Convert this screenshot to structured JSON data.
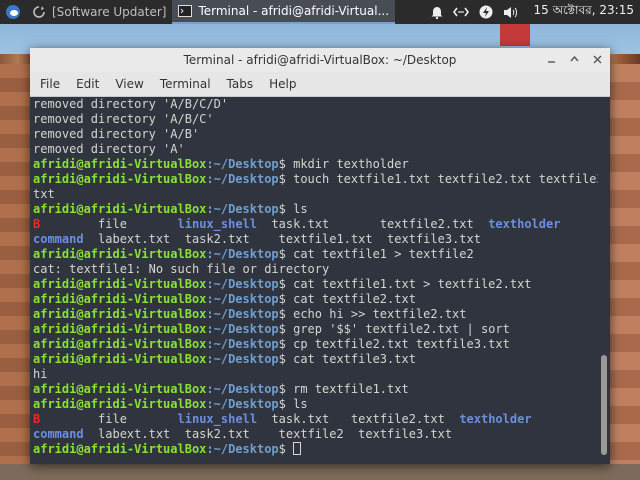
{
  "panel": {
    "tasks": [
      {
        "label": "[Software Updater]",
        "active": false
      },
      {
        "label": "Terminal - afridi@afridi-Virtual...",
        "active": true
      }
    ],
    "clock": "15 অক্টোবর, 23:15",
    "tray_icons": [
      "bell-icon",
      "network-icon",
      "power-icon",
      "volume-icon"
    ]
  },
  "window": {
    "title": "Terminal - afridi@afridi-VirtualBox: ~/Desktop",
    "menu": [
      "File",
      "Edit",
      "View",
      "Terminal",
      "Tabs",
      "Help"
    ]
  },
  "terminal": {
    "user": "afridi@afridi-VirtualBox",
    "path": ":~/Desktop",
    "prompt_char": "$",
    "output_lines": [
      "removed directory 'A/B/C/D'",
      "removed directory 'A/B/C'",
      "removed directory 'A/B'",
      "removed directory 'A'"
    ],
    "commands": [
      " mkdir textholder",
      " touch textfile1.txt textfile2.txt textfile3.",
      "txt",
      " ls",
      " cat textfile1 > textfile2",
      "cat: textfile1: No such file or directory",
      " cat textfile1.txt > textfile2.txt",
      " cat textfile2.txt",
      " echo hi >> textfile2.txt",
      " grep '$$' textfile2.txt | sort",
      " cp textfile2.txt textfile3.txt",
      " cat textfile3.txt",
      "hi",
      " rm textfile1.txt",
      " ls",
      " "
    ],
    "ls1": {
      "row1": [
        "B",
        "file",
        "linux_shell",
        "task.txt",
        "textfile2.txt",
        "textholder"
      ],
      "row2": [
        "command",
        "labext.txt",
        "task2.txt",
        "textfile1.txt",
        "textfile3.txt"
      ]
    },
    "ls2": {
      "row1": [
        "B",
        "file",
        "linux_shell",
        "task.txt",
        "textfile2.txt",
        "textholder"
      ],
      "row2": [
        "command",
        "labext.txt",
        "task2.txt",
        "textfile2",
        "textfile3.txt"
      ]
    }
  }
}
